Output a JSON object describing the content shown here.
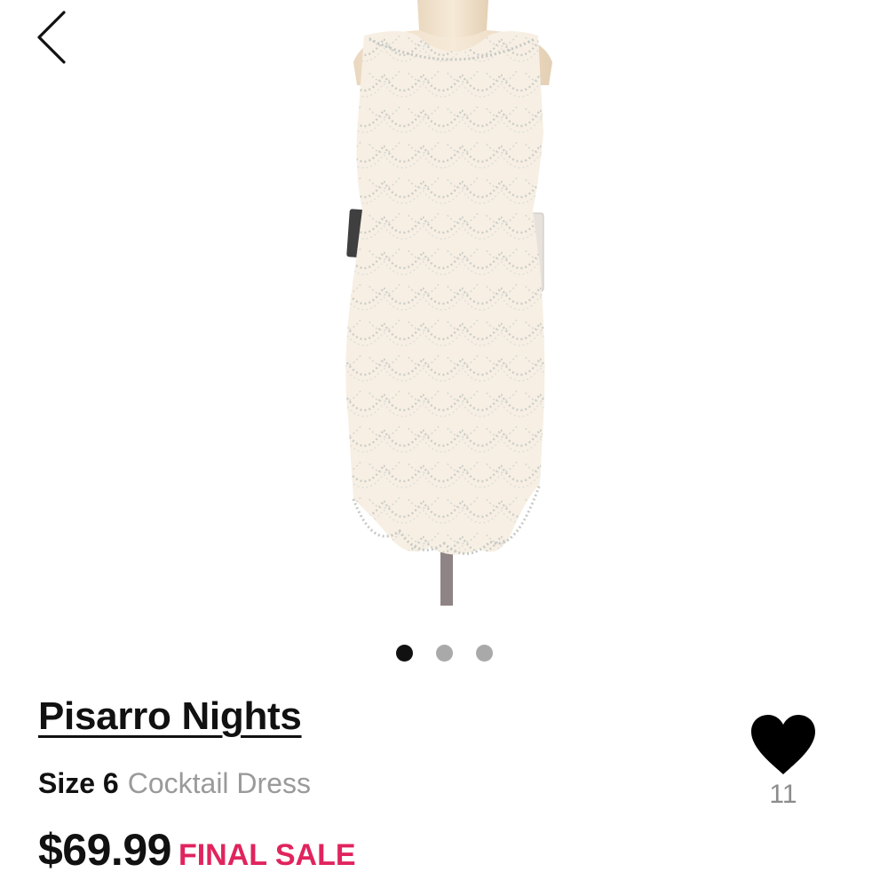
{
  "navigation": {
    "back_icon": "chevron-left-icon"
  },
  "gallery": {
    "image_subject": "beaded cream cocktail dress on mannequin",
    "slide_count": 3,
    "active_index": 0
  },
  "product": {
    "brand": "Pisarro Nights",
    "size_label": "Size 6",
    "category": "Cocktail Dress",
    "price": "$69.99",
    "sale_badge": "FINAL SALE"
  },
  "favorite": {
    "icon": "heart-icon",
    "count": "11"
  },
  "colors": {
    "sale_accent": "#e0245e",
    "primary_text": "#111111",
    "muted_text": "#9a9a9a",
    "dot_active": "#111111",
    "dot_inactive": "#a9a9a9"
  }
}
